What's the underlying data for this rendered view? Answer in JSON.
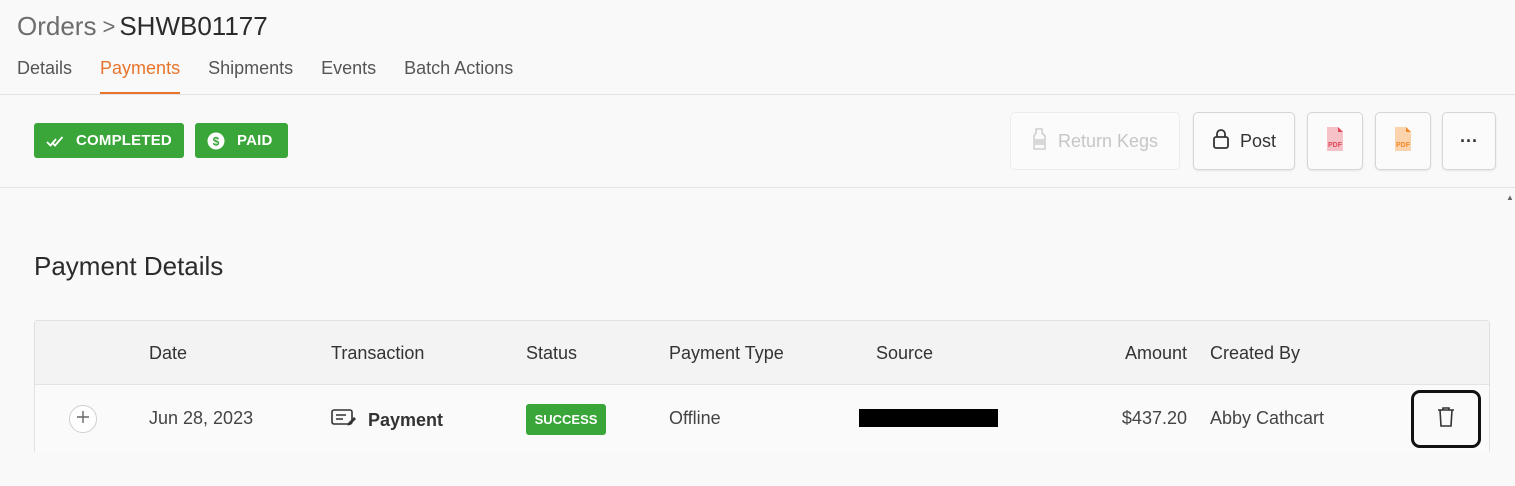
{
  "breadcrumb": {
    "parent": "Orders",
    "separator": ">",
    "current": "SHWB01177"
  },
  "tabs": [
    {
      "label": "Details",
      "active": false
    },
    {
      "label": "Payments",
      "active": true
    },
    {
      "label": "Shipments",
      "active": false
    },
    {
      "label": "Events",
      "active": false
    },
    {
      "label": "Batch Actions",
      "active": false
    }
  ],
  "badges": {
    "completed": {
      "label": "COMPLETED",
      "icon": "double-check-icon"
    },
    "paid": {
      "label": "PAID",
      "icon": "dollar-coin-icon"
    }
  },
  "toolbar": {
    "return_kegs": {
      "label": "Return Kegs",
      "icon": "keg-icon",
      "disabled": true
    },
    "post": {
      "label": "Post",
      "icon": "lock-icon"
    },
    "pdf_red": {
      "icon": "pdf-file-icon",
      "color": "#e0495a",
      "text": "PDF"
    },
    "pdf_orange": {
      "icon": "pdf-file-icon",
      "color": "#f08a2a",
      "text": "PDF"
    },
    "more": {
      "label": "···"
    }
  },
  "section": {
    "title": "Payment Details"
  },
  "table": {
    "columns": [
      "Date",
      "Transaction",
      "Status",
      "Payment Type",
      "Source",
      "Amount",
      "Created By"
    ],
    "rows": [
      {
        "date": "Jun 28, 2023",
        "transaction": "Payment",
        "status": "SUCCESS",
        "payment_type": "Offline",
        "source": "[redacted]",
        "amount": "$437.20",
        "created_by": "Abby Cathcart"
      }
    ]
  },
  "colors": {
    "accent": "#e8742c",
    "success": "#3aa63a"
  }
}
